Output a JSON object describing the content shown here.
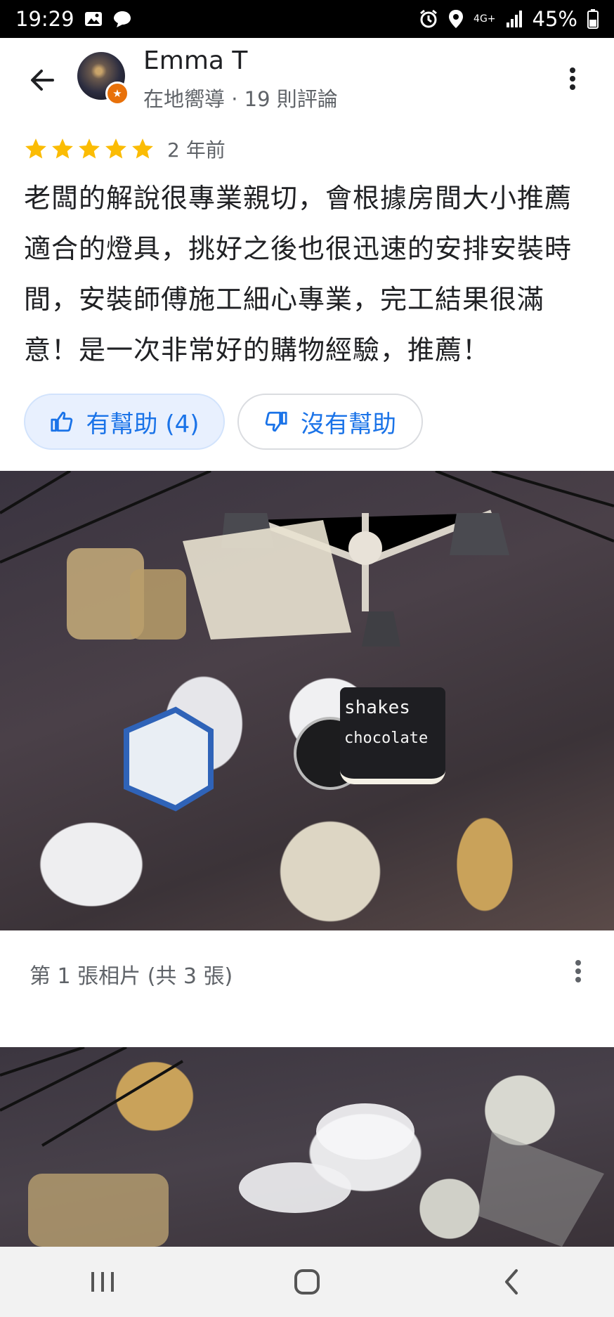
{
  "status_bar": {
    "time": "19:29",
    "network": "4G+",
    "battery": "45%",
    "icons": [
      "image-icon",
      "chat-icon",
      "alarm-icon",
      "location-icon",
      "signal-icon",
      "battery-icon"
    ]
  },
  "reviewer": {
    "name": "Emma T",
    "subtitle": "在地嚮導 · 19 則評論"
  },
  "review": {
    "stars": 5,
    "time": "2 年前",
    "text": "老闆的解說很專業親切，會根據房間大小推薦適合的燈具，挑好之後也很迅速的安排安裝時間，安裝師傅施工細心專業，完工結果很滿意！是一次非常好的購物經驗，推薦！"
  },
  "actions": {
    "helpful_label": "有幫助 (4)",
    "unhelpful_label": "沒有幫助"
  },
  "photo": {
    "lamp_text_1": "shakes",
    "lamp_text_2": "chocolate",
    "caption": "第 1 張相片 (共 3 張)"
  },
  "colors": {
    "accent": "#1a73e8",
    "star": "#fbbc04",
    "badge": "#e8710a"
  }
}
